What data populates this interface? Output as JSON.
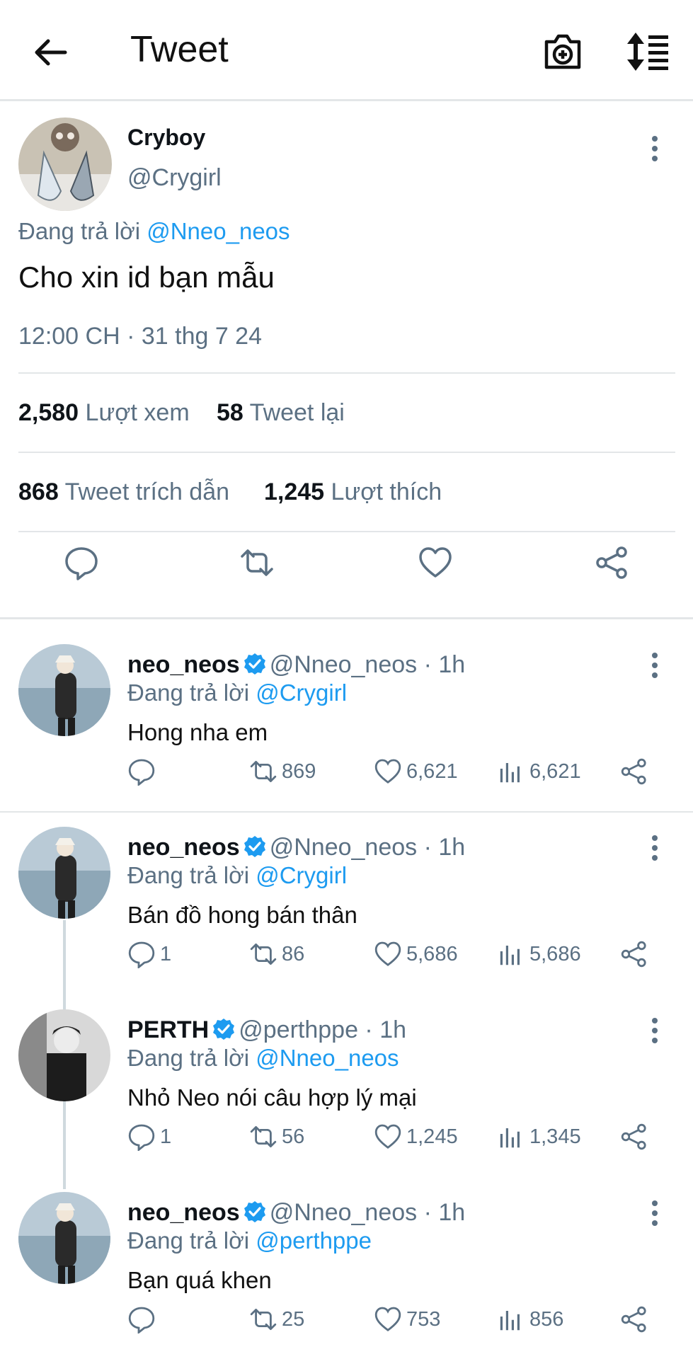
{
  "header": {
    "title": "Tweet"
  },
  "main": {
    "name": "Cryboy",
    "handle": "@Crygirl",
    "reply_prefix": "Đang trả lời ",
    "reply_to": "@Nneo_neos",
    "text": "Cho xin id bạn mẫu",
    "time": "12:00 CH · 31 thg 7 24",
    "views_count": "2,580",
    "views_label": "Lượt xem",
    "retweets_count": "58",
    "retweets_label": "Tweet lại",
    "quotes_count": "868",
    "quotes_label": "Tweet trích dẫn",
    "likes_count": "1,245",
    "likes_label": "Lượt thích"
  },
  "replies": [
    {
      "name": "neo_neos",
      "handle": "@Nneo_neos",
      "age": "1h",
      "reply_prefix": "Đang trả lời ",
      "reply_to": "@Crygirl",
      "text": "Hong nha em",
      "replies": "",
      "retweets": "869",
      "likes": "6,621",
      "views": "6,621"
    },
    {
      "name": "neo_neos",
      "handle": "@Nneo_neos",
      "age": "1h",
      "reply_prefix": "Đang trả lời ",
      "reply_to": "@Crygirl",
      "text": "Bán đồ hong bán thân",
      "replies": "1",
      "retweets": "86",
      "likes": "5,686",
      "views": "5,686"
    },
    {
      "name": "PERTH",
      "handle": "@perthppe",
      "age": "1h",
      "reply_prefix": "Đang trả lời ",
      "reply_to": "@Nneo_neos",
      "text": "Nhỏ Neo nói câu hợp lý mại",
      "replies": "1",
      "retweets": "56",
      "likes": "1,245",
      "views": "1,345"
    },
    {
      "name": "neo_neos",
      "handle": "@Nneo_neos",
      "age": "1h",
      "reply_prefix": "Đang trả lời ",
      "reply_to": "@perthppe",
      "text": "Bạn quá khen",
      "replies": "",
      "retweets": "25",
      "likes": "753",
      "views": "856"
    }
  ],
  "colors": {
    "link": "#1d9bf0",
    "secondary": "#5b7083",
    "verified": "#1d9bf0"
  }
}
